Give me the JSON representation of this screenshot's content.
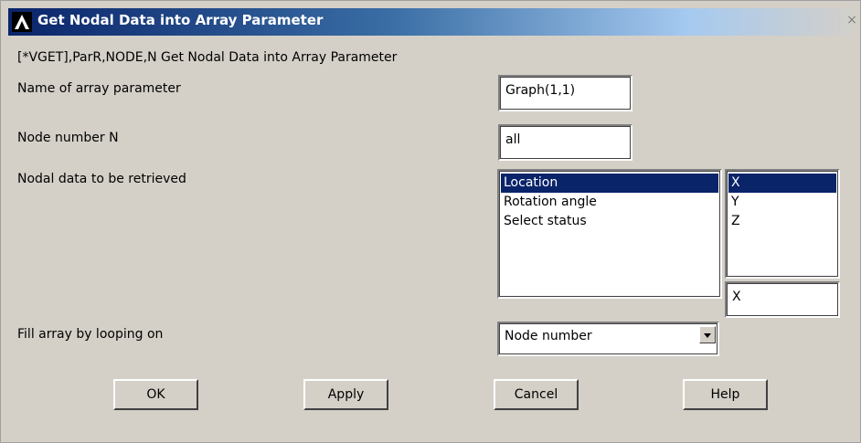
{
  "window": {
    "title": "Get Nodal Data into Array Parameter",
    "close_label": "×",
    "logo_icon": "ansys-logo-icon"
  },
  "command": {
    "text": "[*VGET],ParR,NODE,N  Get Nodal Data into Array Parameter"
  },
  "fields": {
    "array_name": {
      "label": "Name of array parameter",
      "value": "Graph(1,1)"
    },
    "node_number": {
      "label": "Node number N",
      "value": "all"
    },
    "nodal_data": {
      "label": "Nodal data to be retrieved",
      "items": [
        "Location",
        "Rotation angle",
        "Select status"
      ],
      "selected": "Location",
      "components": [
        "X",
        "Y",
        "Z"
      ],
      "selected_component": "X",
      "component_value": "X"
    },
    "fill_loop": {
      "label": "Fill array by looping on",
      "value": "Node number"
    }
  },
  "buttons": {
    "ok": "OK",
    "apply": "Apply",
    "cancel": "Cancel",
    "help": "Help"
  },
  "colors": {
    "selection": "#0a246a",
    "dialog_bg": "#d4d0c8"
  }
}
